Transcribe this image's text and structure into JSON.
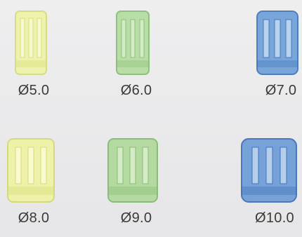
{
  "sizes": [
    {
      "label": "Ø5.0",
      "fill": "#eef3a6",
      "stroke": "#d6dc7a",
      "slot": "#f8fbd2"
    },
    {
      "label": "Ø6.0",
      "fill": "#b4dca0",
      "stroke": "#86bd73",
      "slot": "#d9efcc"
    },
    {
      "label": "Ø7.0",
      "fill": "#6d9fd8",
      "stroke": "#3f72b8",
      "slot": "#c6dcf3"
    },
    {
      "label": "Ø8.0",
      "fill": "#eff3a2",
      "stroke": "#d3d873",
      "slot": "#fafcd6"
    },
    {
      "label": "Ø9.0",
      "fill": "#afd99b",
      "stroke": "#81b96d",
      "slot": "#dcf0cf"
    },
    {
      "label": "Ø10.0",
      "fill": "#6a9bd6",
      "stroke": "#3a6cb4",
      "slot": "#c2d8f1"
    }
  ]
}
